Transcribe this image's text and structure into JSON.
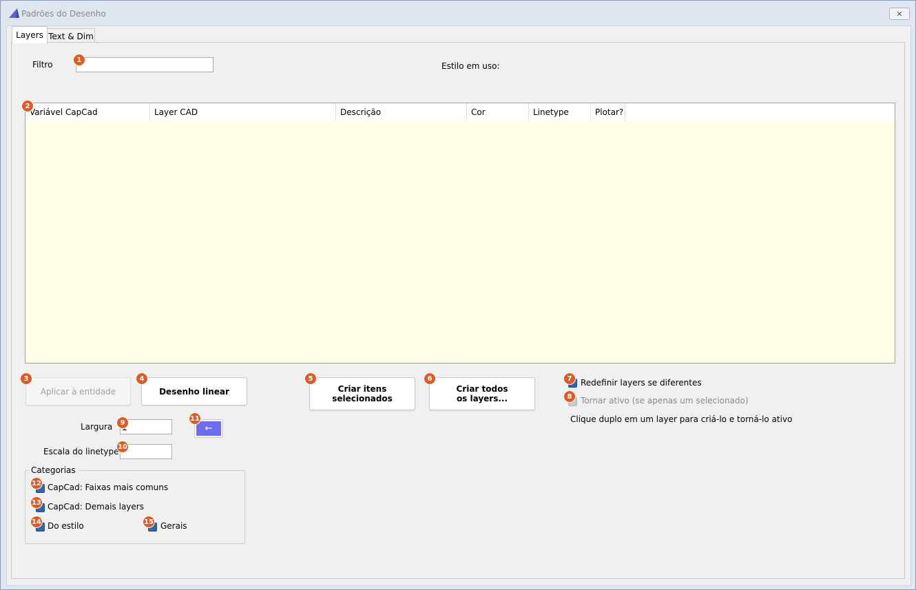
{
  "window": {
    "title": "Padrões do Desenho",
    "close_symbol": "✕"
  },
  "tabs": [
    {
      "label": "Layers",
      "active": true
    },
    {
      "label": "Text & Dim",
      "active": false
    }
  ],
  "filter": {
    "label": "Filtro",
    "value": ""
  },
  "style_in_use": {
    "label": "Estilo em uso:"
  },
  "grid": {
    "columns": [
      "Variável CapCad",
      "Layer CAD",
      "Descrição",
      "Cor",
      "Linetype",
      "Plotar?"
    ],
    "background": "#ffffe6"
  },
  "buttons": {
    "apply_entity": "Aplicar à entidade",
    "linear_drawing": "Desenho linear",
    "create_selected": "Criar itens selecionados",
    "create_all": "Criar todos os layers...",
    "arrow": "←"
  },
  "options": {
    "redefine_label": "Redefinir layers se diferentes",
    "make_active_label": "Tornar ativo (se apenas um selecionado)",
    "hint": "Clique duplo em um layer para criá-lo e torná-lo ativo"
  },
  "fields": {
    "width_label": "Largura",
    "width_value": "1",
    "linetype_scale_label": "Escala do linetype",
    "linetype_scale_value": ""
  },
  "categories": {
    "title": "Categorias",
    "items": [
      "CapCad: Faixas mais comuns",
      "CapCad: Demais layers",
      "Do estilo",
      "Gerais"
    ]
  },
  "badges": [
    "1",
    "2",
    "3",
    "4",
    "5",
    "6",
    "7",
    "8",
    "9",
    "10",
    "11",
    "12",
    "13",
    "14",
    "15"
  ],
  "colors": {
    "badge": "#e05a23",
    "arrow_button": "#6c6cf2",
    "checkbox": "#2d66b4"
  }
}
